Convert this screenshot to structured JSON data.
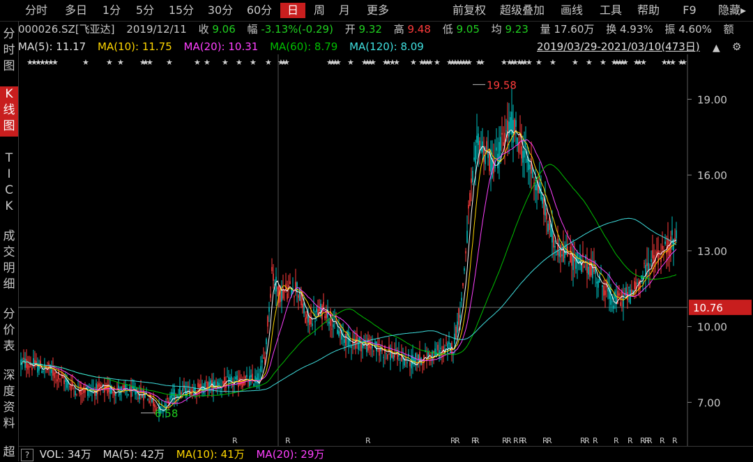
{
  "colors": {
    "up": "#ff3c3c",
    "down": "#00c0c0",
    "ma5": "#ffffff",
    "ma10": "#ffd700",
    "ma20": "#ff40ff",
    "ma60": "#00c000",
    "ma120": "#40e0e0",
    "accent": "#c81e1e",
    "green_text": "#20d020",
    "red_text": "#ff3c3c"
  },
  "topbar": {
    "items": [
      "分时",
      "多日",
      "1分",
      "5分",
      "15分",
      "30分",
      "60分",
      "日",
      "周",
      "月",
      "更多"
    ],
    "active": "日",
    "right_items": [
      "前复权",
      "超级叠加",
      "画线",
      "工具",
      "帮助",
      "F9",
      "隐藏▸"
    ]
  },
  "leftnav": {
    "items": [
      {
        "label": "分\n时\n图",
        "active": false
      },
      {
        "label": "K\n线\n图",
        "active": true
      },
      {
        "label": "T\nI\nC\nK",
        "active": false
      },
      {
        "label": "成\n交\n明\n细",
        "active": false
      },
      {
        "label": "分\n价\n表",
        "active": false
      },
      {
        "label": "深\n度\n资\n料",
        "active": false
      },
      {
        "label": "超",
        "active": false
      }
    ]
  },
  "info": {
    "code": "000026.SZ[飞亚达]",
    "date": "2019/12/11",
    "close_label": "收",
    "close": "9.06",
    "change_label": "幅",
    "change": "-3.13%(-0.29)",
    "open_label": "开",
    "open": "9.32",
    "high_label": "高",
    "high": "9.48",
    "low_label": "低",
    "low": "9.05",
    "avg_label": "均",
    "avg": "9.23",
    "vol_label": "量",
    "vol": "17.60万",
    "turnover_label": "换",
    "turnover": "4.93%",
    "amp_label": "振",
    "amp": "4.60%",
    "amount_label": "额"
  },
  "ma": {
    "ma5": "MA(5): 11.17",
    "ma10": "MA(10): 11.75",
    "ma20": "MA(20): 10.31",
    "ma60": "MA(60): 8.79",
    "ma120": "MA(120): 8.09",
    "range": "2019/03/29-2021/03/10(473日)"
  },
  "chart_data": {
    "type": "candlestick",
    "y_ticks": [
      "19.00",
      "16.00",
      "13.00",
      "10.00",
      "7.00"
    ],
    "y_tick_values": [
      19,
      16,
      13,
      10,
      7
    ],
    "ylim": [
      6.1,
      19.95
    ],
    "current_price": "10.76",
    "current_price_value": 10.76,
    "high_label": "19.58",
    "low_label": "6.58",
    "series": [
      {
        "name": "MA5",
        "color": "#ffffff"
      },
      {
        "name": "MA10",
        "color": "#ffd700"
      },
      {
        "name": "MA20",
        "color": "#ff40ff"
      },
      {
        "name": "MA60",
        "color": "#00c000"
      },
      {
        "name": "MA120",
        "color": "#40e0e0"
      }
    ]
  },
  "vol": {
    "icon": "?",
    "vol": "VOL: 34万",
    "ma5": "MA(5): 42万",
    "ma10": "MA(10): 41万",
    "ma20": "MA(20): 29万"
  }
}
